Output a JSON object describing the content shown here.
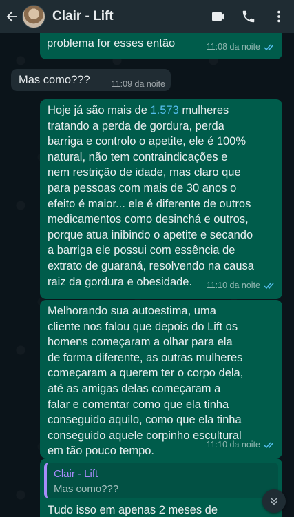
{
  "header": {
    "contact_name": "Clair - Lift",
    "back_icon": "arrow-left-icon",
    "video_icon": "videocam-icon",
    "call_icon": "phone-icon",
    "menu_icon": "more-vert-icon"
  },
  "messages": [
    {
      "direction": "outgoing",
      "text": "problema for esses então",
      "time": "11:08 da noite",
      "read": true
    },
    {
      "direction": "incoming",
      "text": "Mas como???",
      "time": "11:09 da noite"
    },
    {
      "direction": "outgoing",
      "text_before": "Hoje já são mais de ",
      "highlight": "1.573",
      "text_after": " mulheres\ntratando a perda de gordura, perda\nbarriga e controlo o apetite, ele é 100%\nnatural, não tem contraindicações e\nnem restrição de idade, mas claro que\npara pessoas com mais de 30 anos o\nefeito é maior... ele é diferente de outros\nmedicamentos como desinchá e outros,\nporque atua inibindo o apetite e secando\na barriga ele possui com essência de\nextrato de guaraná, resolvendo na causa\nraiz da gordura e obesidade.",
      "time": "11:10 da noite",
      "read": true
    },
    {
      "direction": "outgoing",
      "text": "Melhorando sua autoestima, uma\ncliente nos falou que depois do Lift os\nhomens começaram a olhar para ela\nde forma diferente, as outras mulheres\ncomeçaram a querem ter o corpo dela,\naté as amigas delas começaram a\nfalar e comentar como que ela tinha\nconseguido aquilo, como que ela tinha\nconseguido aquele corpinho escultural\nem tão pouco tempo.",
      "time": "11:10 da noite",
      "read": true
    },
    {
      "direction": "outgoing",
      "quoted_name": "Clair - Lift",
      "quoted_text": "Mas como???",
      "text": "Tudo isso em apenas 2 meses de"
    }
  ],
  "colors": {
    "outgoing_bubble": "#005c4b",
    "incoming_bubble": "#202c33",
    "header_bg": "#1f2c33",
    "read_tick": "#53bdeb",
    "highlight": "#53bdeb",
    "quote_accent": "#a78bfa"
  },
  "scroll_button_icon": "chevrons-down-icon"
}
